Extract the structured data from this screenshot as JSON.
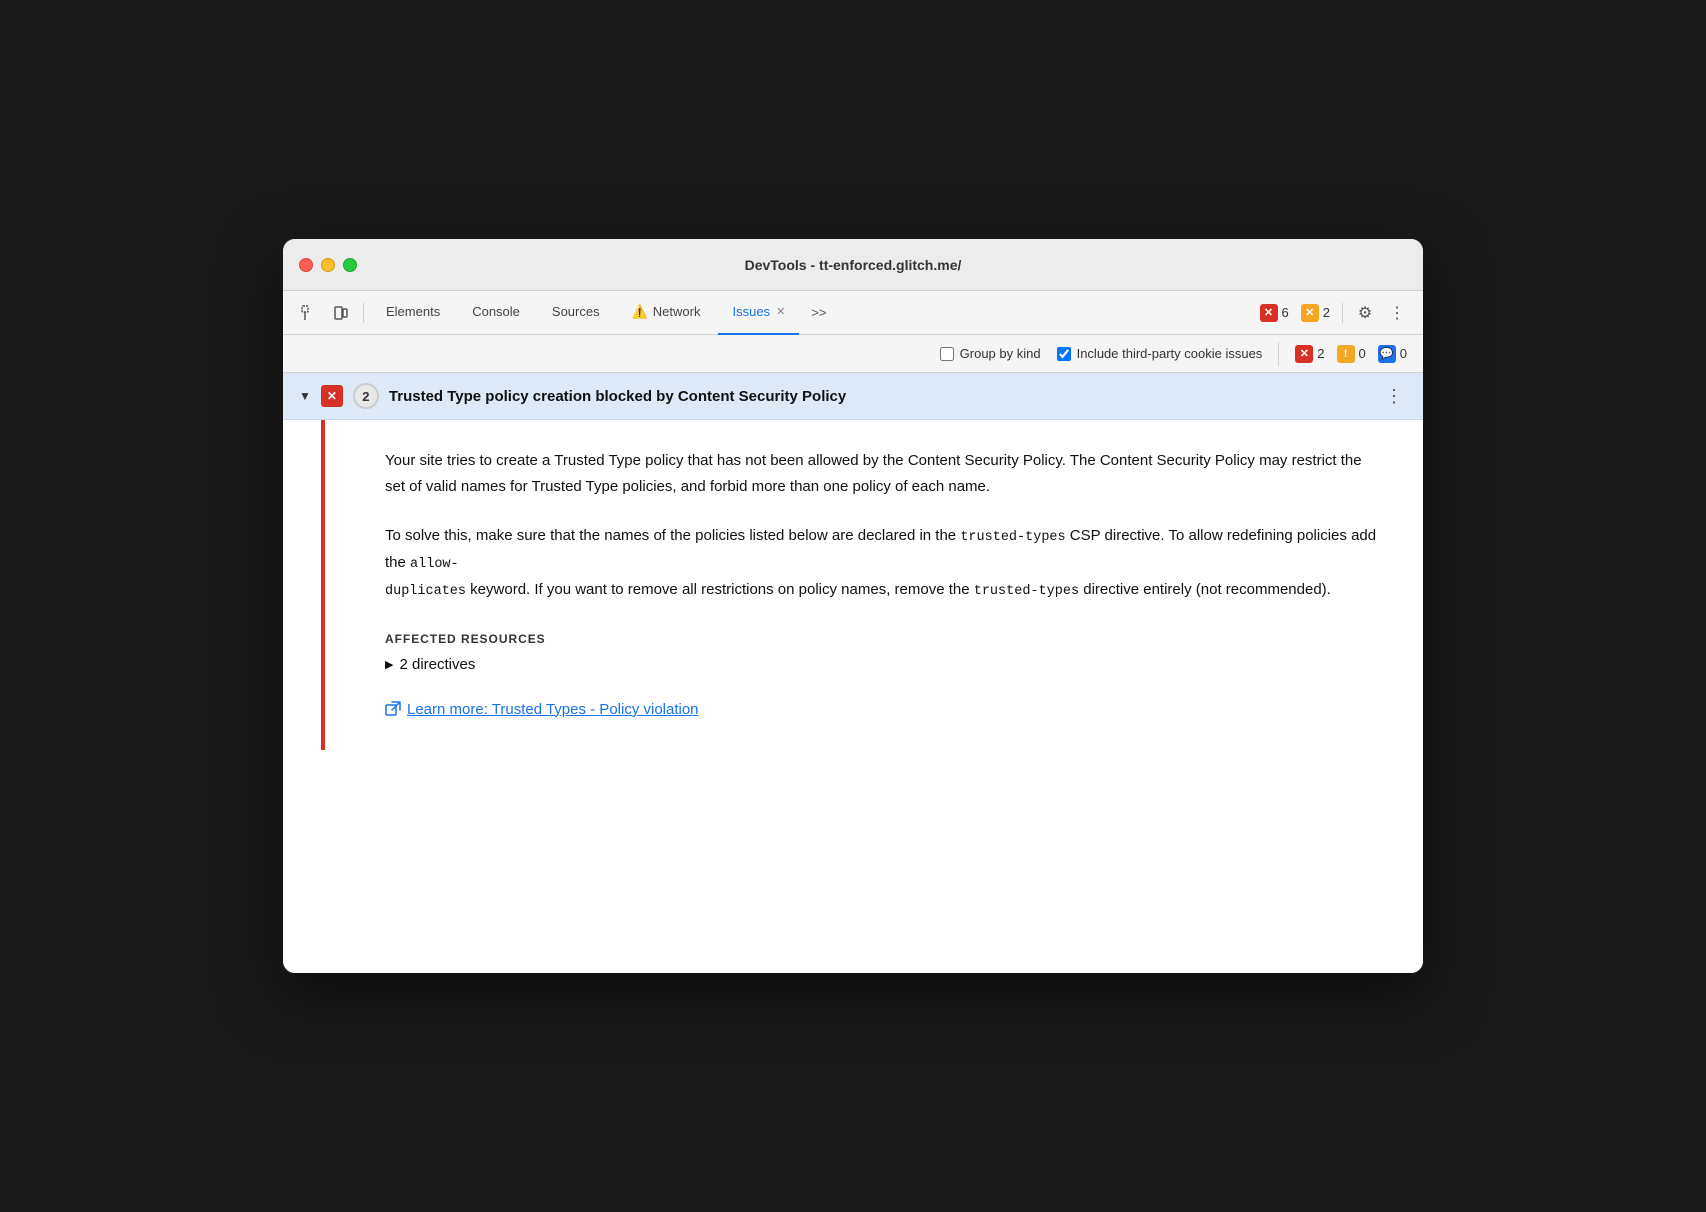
{
  "window": {
    "title": "DevTools - tt-enforced.glitch.me/"
  },
  "toolbar": {
    "tabs": [
      {
        "id": "elements",
        "label": "Elements",
        "active": false,
        "warning": false,
        "closeable": false
      },
      {
        "id": "console",
        "label": "Console",
        "active": false,
        "warning": false,
        "closeable": false
      },
      {
        "id": "sources",
        "label": "Sources",
        "active": false,
        "warning": false,
        "closeable": false
      },
      {
        "id": "network",
        "label": "Network",
        "active": false,
        "warning": true,
        "closeable": false
      },
      {
        "id": "issues",
        "label": "Issues",
        "active": true,
        "warning": false,
        "closeable": true
      }
    ],
    "more_tabs_label": ">>",
    "error_count": "6",
    "warning_count": "2",
    "settings_label": "⚙",
    "more_label": "⋮"
  },
  "issues_bar": {
    "group_by_kind_label": "Group by kind",
    "group_by_kind_checked": false,
    "include_third_party_label": "Include third-party cookie issues",
    "include_third_party_checked": true,
    "error_count": "2",
    "warning_count": "0",
    "info_count": "0"
  },
  "issue": {
    "chevron": "▼",
    "type_badge": "✕",
    "count": "2",
    "title": "Trusted Type policy creation blocked by Content Security Policy",
    "more_options": "⋮",
    "description": "Your site tries to create a Trusted Type policy that has not been allowed by the Content Security Policy. The Content Security Policy may restrict the set of valid names for Trusted Type policies, and forbid more than one policy of each name.",
    "solution_part1": "To solve this, make sure that the names of the policies listed below are declared in the ",
    "solution_code1": "trusted-types",
    "solution_part2": " CSP directive. To allow redefining policies add the ",
    "solution_code2": "allow-\nduplicates",
    "solution_part3": " keyword. If you want to remove all restrictions on policy names, remove the ",
    "solution_code3": "trusted-types",
    "solution_part4": " directive entirely (not recommended).",
    "affected_resources_title": "AFFECTED RESOURCES",
    "directives_label": "2 directives",
    "learn_more_label": "Learn more: Trusted Types - Policy violation",
    "learn_more_url": "#"
  }
}
